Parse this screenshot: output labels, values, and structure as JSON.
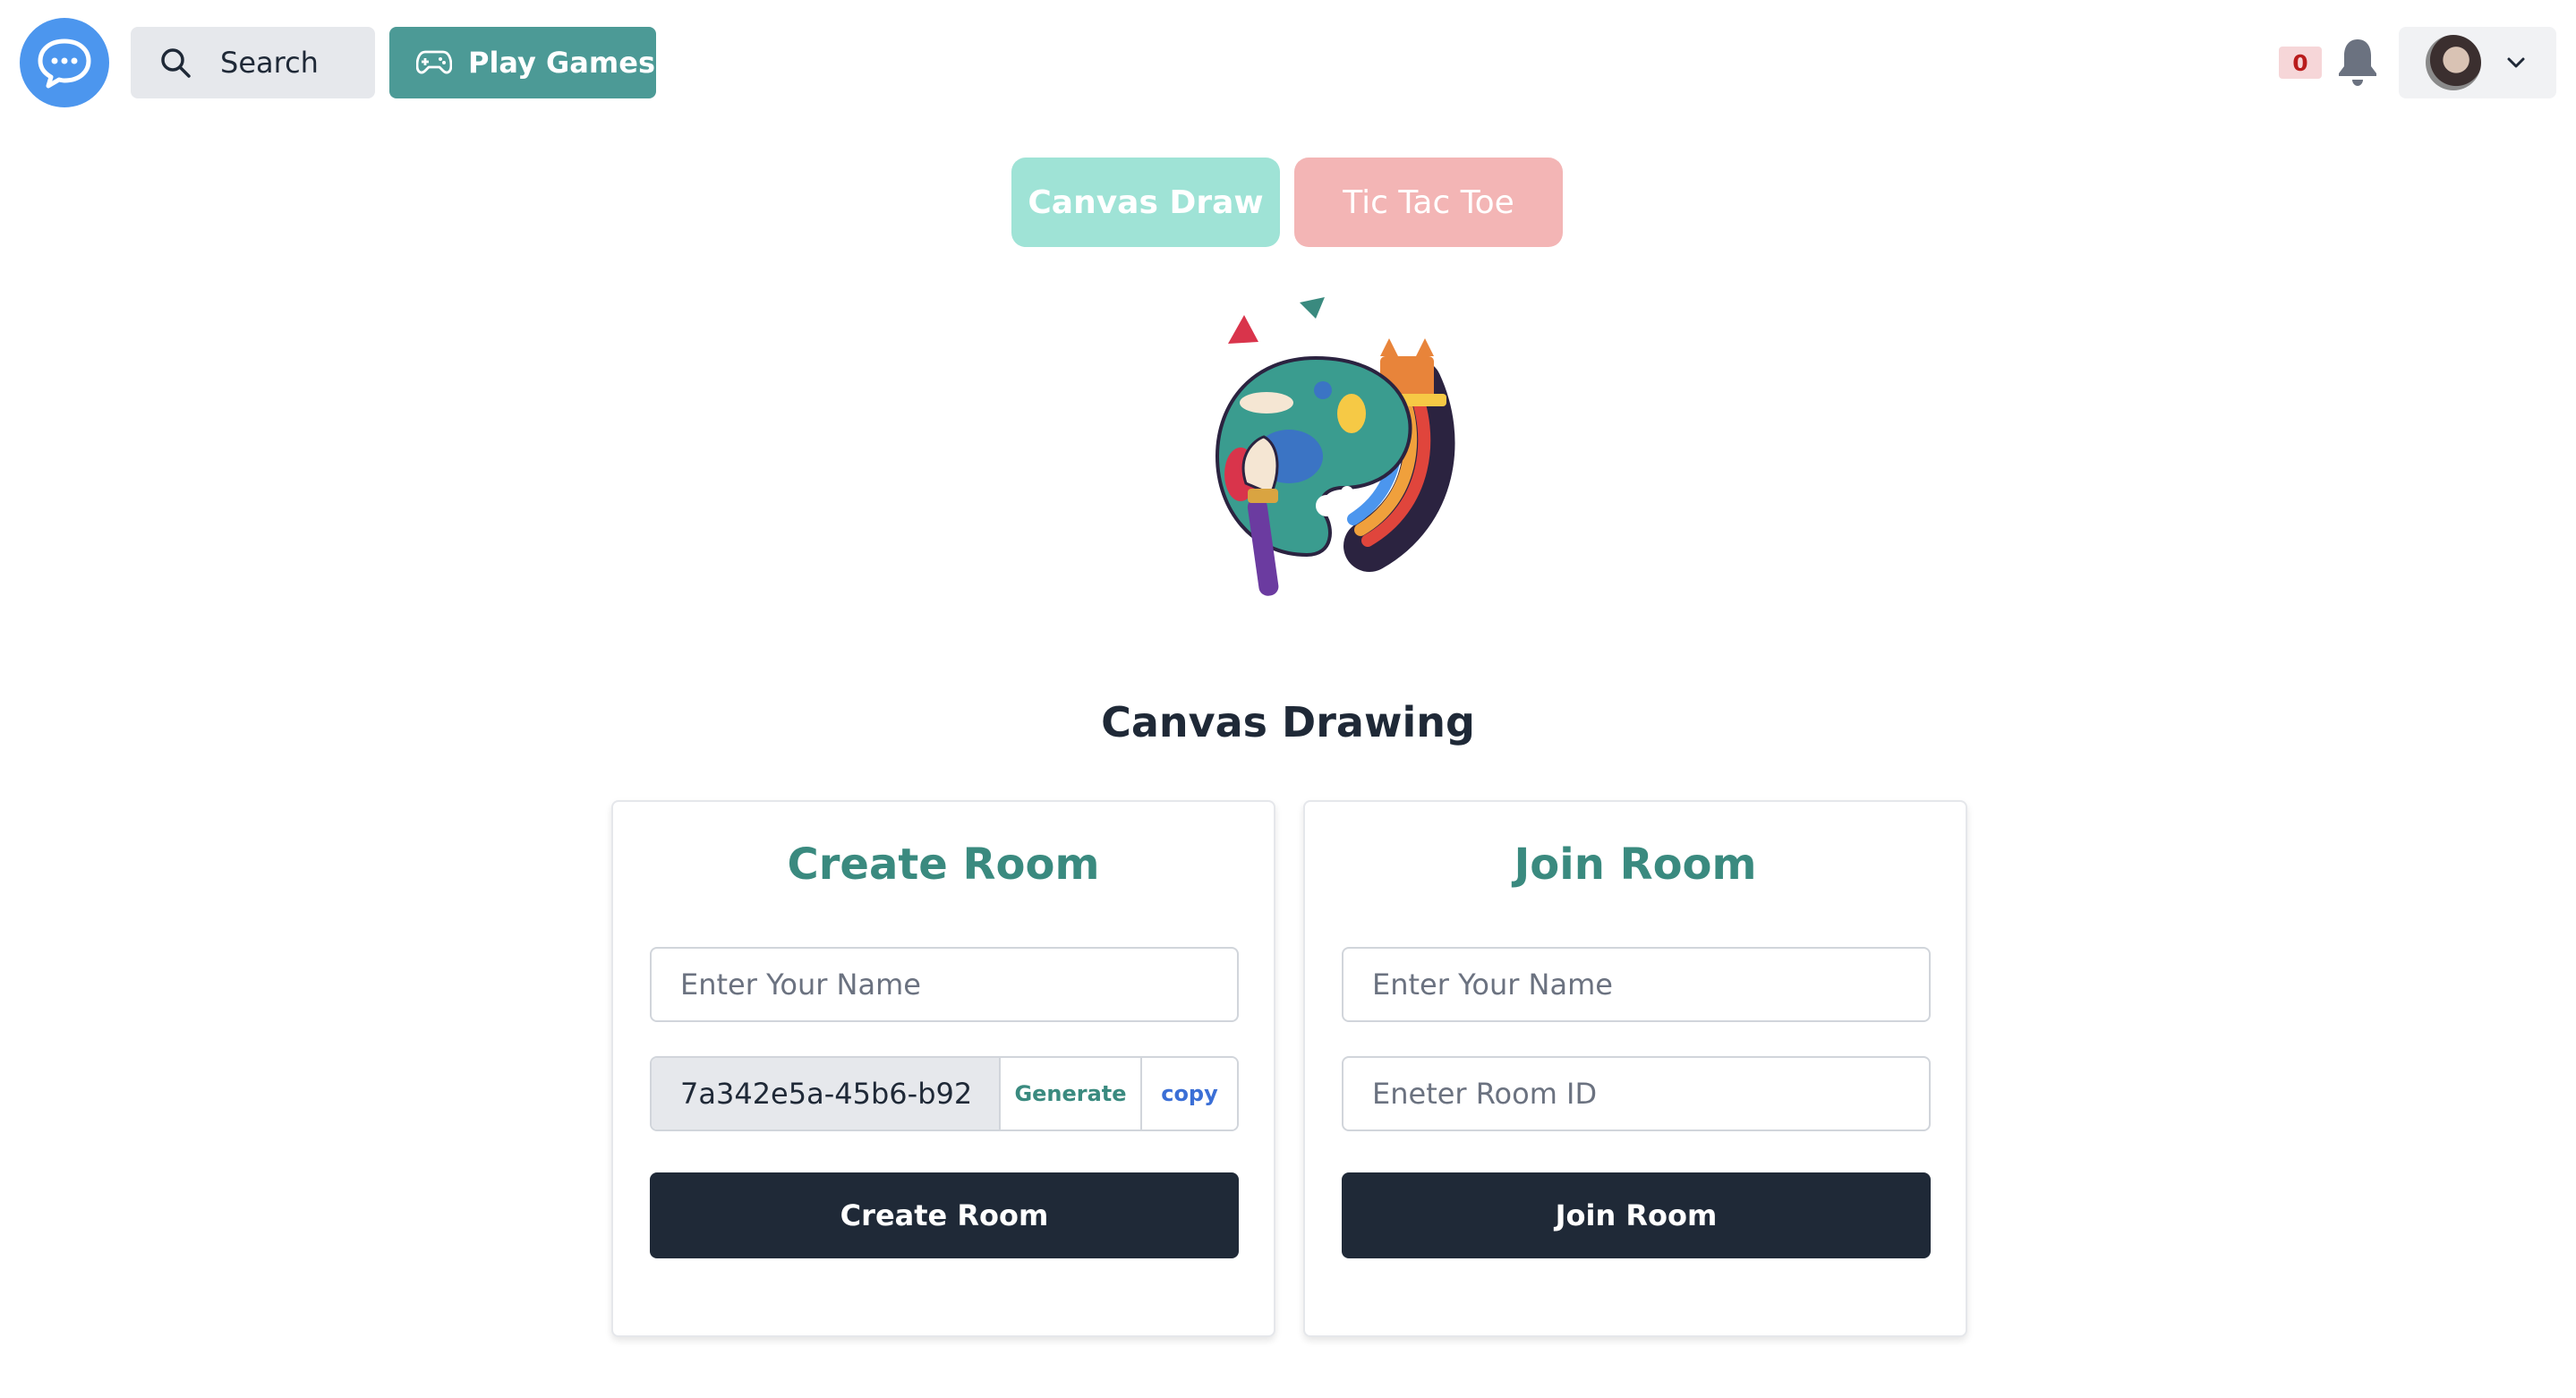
{
  "header": {
    "logo_icon": "chat-bubble-icon",
    "search_label": "Search",
    "play_games_label": "Play Games",
    "notification_count": "0",
    "accent": "#4c9a96",
    "logo_color": "#4c96ee"
  },
  "game_tabs": [
    {
      "label": "Canvas Draw",
      "active": true
    },
    {
      "label": "Tic Tac Toe",
      "active": false
    }
  ],
  "page": {
    "title": "Canvas Drawing"
  },
  "create_room": {
    "title": "Create Room",
    "name_placeholder": "Enter Your Name",
    "room_id_value": "7a342e5a-45b6-b92",
    "generate_label": "Generate",
    "copy_label": "copy",
    "submit_label": "Create Room"
  },
  "join_room": {
    "title": "Join Room",
    "name_placeholder": "Enter Your Name",
    "room_id_placeholder": "Eneter Room ID",
    "submit_label": "Join Room"
  }
}
